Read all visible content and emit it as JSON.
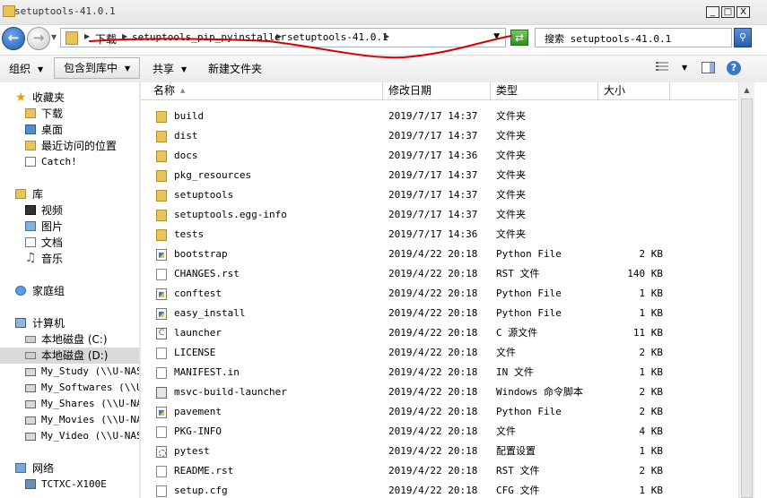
{
  "window": {
    "title": "setuptools-41.0.1",
    "min": "_",
    "max": "□",
    "close": "X"
  },
  "address": {
    "crumbs": [
      "下载",
      "setuptools_pip_pyinstaller",
      "setuptools-41.0.1"
    ],
    "search_placeholder": "搜索 setuptools-41.0.1"
  },
  "toolbar": {
    "organize": "组织",
    "include": "包含到库中",
    "share": "共享",
    "new_folder": "新建文件夹"
  },
  "nav": {
    "favorites": "收藏夹",
    "fav_items": [
      "下载",
      "桌面",
      "最近访问的位置",
      "Catch!"
    ],
    "libraries": "库",
    "lib_items": [
      "视频",
      "图片",
      "文档",
      "音乐"
    ],
    "homegroup": "家庭组",
    "computer": "计算机",
    "drives": [
      "本地磁盘 (C:)",
      "本地磁盘 (D:)"
    ],
    "network_drives": [
      "My_Study (\\\\U-NAS",
      "My_Softwares (\\\\U-",
      "My_Shares (\\\\U-NAS",
      "My_Movies (\\\\U-NAS",
      "My_Video (\\\\U-NAS)"
    ],
    "network": "网络",
    "network_items": [
      "TCTXC-X100E"
    ]
  },
  "columns": {
    "name": "名称",
    "modified": "修改日期",
    "type": "类型",
    "size": "大小"
  },
  "files": [
    {
      "name": "build",
      "date": "2019/7/17 14:37",
      "type": "文件夹",
      "size": "",
      "icon": "folder"
    },
    {
      "name": "dist",
      "date": "2019/7/17 14:37",
      "type": "文件夹",
      "size": "",
      "icon": "folder"
    },
    {
      "name": "docs",
      "date": "2019/7/17 14:36",
      "type": "文件夹",
      "size": "",
      "icon": "folder"
    },
    {
      "name": "pkg_resources",
      "date": "2019/7/17 14:37",
      "type": "文件夹",
      "size": "",
      "icon": "folder"
    },
    {
      "name": "setuptools",
      "date": "2019/7/17 14:37",
      "type": "文件夹",
      "size": "",
      "icon": "folder"
    },
    {
      "name": "setuptools.egg-info",
      "date": "2019/7/17 14:37",
      "type": "文件夹",
      "size": "",
      "icon": "folder"
    },
    {
      "name": "tests",
      "date": "2019/7/17 14:36",
      "type": "文件夹",
      "size": "",
      "icon": "folder"
    },
    {
      "name": "bootstrap",
      "date": "2019/4/22 20:18",
      "type": "Python File",
      "size": "2 KB",
      "icon": "python"
    },
    {
      "name": "CHANGES.rst",
      "date": "2019/4/22 20:18",
      "type": "RST 文件",
      "size": "140 KB",
      "icon": "plain"
    },
    {
      "name": "conftest",
      "date": "2019/4/22 20:18",
      "type": "Python File",
      "size": "1 KB",
      "icon": "python"
    },
    {
      "name": "easy_install",
      "date": "2019/4/22 20:18",
      "type": "Python File",
      "size": "1 KB",
      "icon": "python"
    },
    {
      "name": "launcher",
      "date": "2019/4/22 20:18",
      "type": "C 源文件",
      "size": "11 KB",
      "icon": "csrc"
    },
    {
      "name": "LICENSE",
      "date": "2019/4/22 20:18",
      "type": "文件",
      "size": "2 KB",
      "icon": "plain"
    },
    {
      "name": "MANIFEST.in",
      "date": "2019/4/22 20:18",
      "type": "IN 文件",
      "size": "1 KB",
      "icon": "plain"
    },
    {
      "name": "msvc-build-launcher",
      "date": "2019/4/22 20:18",
      "type": "Windows 命令脚本",
      "size": "2 KB",
      "icon": "app"
    },
    {
      "name": "pavement",
      "date": "2019/4/22 20:18",
      "type": "Python File",
      "size": "2 KB",
      "icon": "python"
    },
    {
      "name": "PKG-INFO",
      "date": "2019/4/22 20:18",
      "type": "文件",
      "size": "4 KB",
      "icon": "plain"
    },
    {
      "name": "pytest",
      "date": "2019/4/22 20:18",
      "type": "配置设置",
      "size": "1 KB",
      "icon": "cfg"
    },
    {
      "name": "README.rst",
      "date": "2019/4/22 20:18",
      "type": "RST 文件",
      "size": "2 KB",
      "icon": "plain"
    },
    {
      "name": "setup.cfg",
      "date": "2019/4/22 20:18",
      "type": "CFG 文件",
      "size": "1 KB",
      "icon": "plain"
    }
  ],
  "colors": {
    "selection": "#d9d9d9",
    "annotation": "#d40000",
    "folder": "#e8c55a"
  }
}
